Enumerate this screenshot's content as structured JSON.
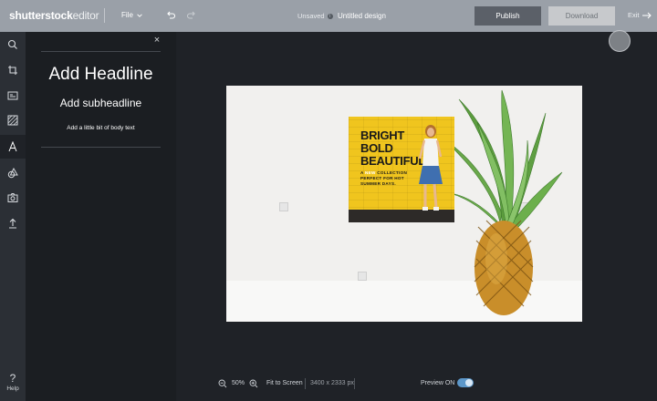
{
  "app": {
    "logo_brand": "shutterstock",
    "logo_product": "editor",
    "file_menu_label": "File",
    "doc_status": "Unsaved",
    "doc_title": "Untitled design",
    "publish_label": "Publish",
    "download_label": "Download",
    "exit_label": "Exit"
  },
  "rail": {
    "icons": [
      "search-icon",
      "crop-icon",
      "template-icon",
      "background-icon",
      "text-icon",
      "shapes-icon",
      "camera-icon",
      "upload-icon"
    ],
    "active_index": 4,
    "help_label": "Help"
  },
  "panel": {
    "headline": "Add Headline",
    "subheadline": "Add subheadline",
    "body": "Add a little bit of body text"
  },
  "poster": {
    "line1": "BRIGHT",
    "line2": "BOLD",
    "line3": "BEAUTIFUL",
    "small1_prefix": "A",
    "small1_highlight": "NEW",
    "small1_suffix": "COLLECTION",
    "small2": "PERFECT FOR HOT",
    "small3": "SUMMER DAYS."
  },
  "bottombar": {
    "zoom_level": "50%",
    "fit_label": "Fit to Screen",
    "dimensions": "3400 x 2333 px",
    "preview_label": "Preview ON",
    "preview_on": true
  },
  "colors": {
    "topbar": "#9aa0a8",
    "accent": "#5c97c9",
    "poster_yellow": "#f0c51e"
  }
}
